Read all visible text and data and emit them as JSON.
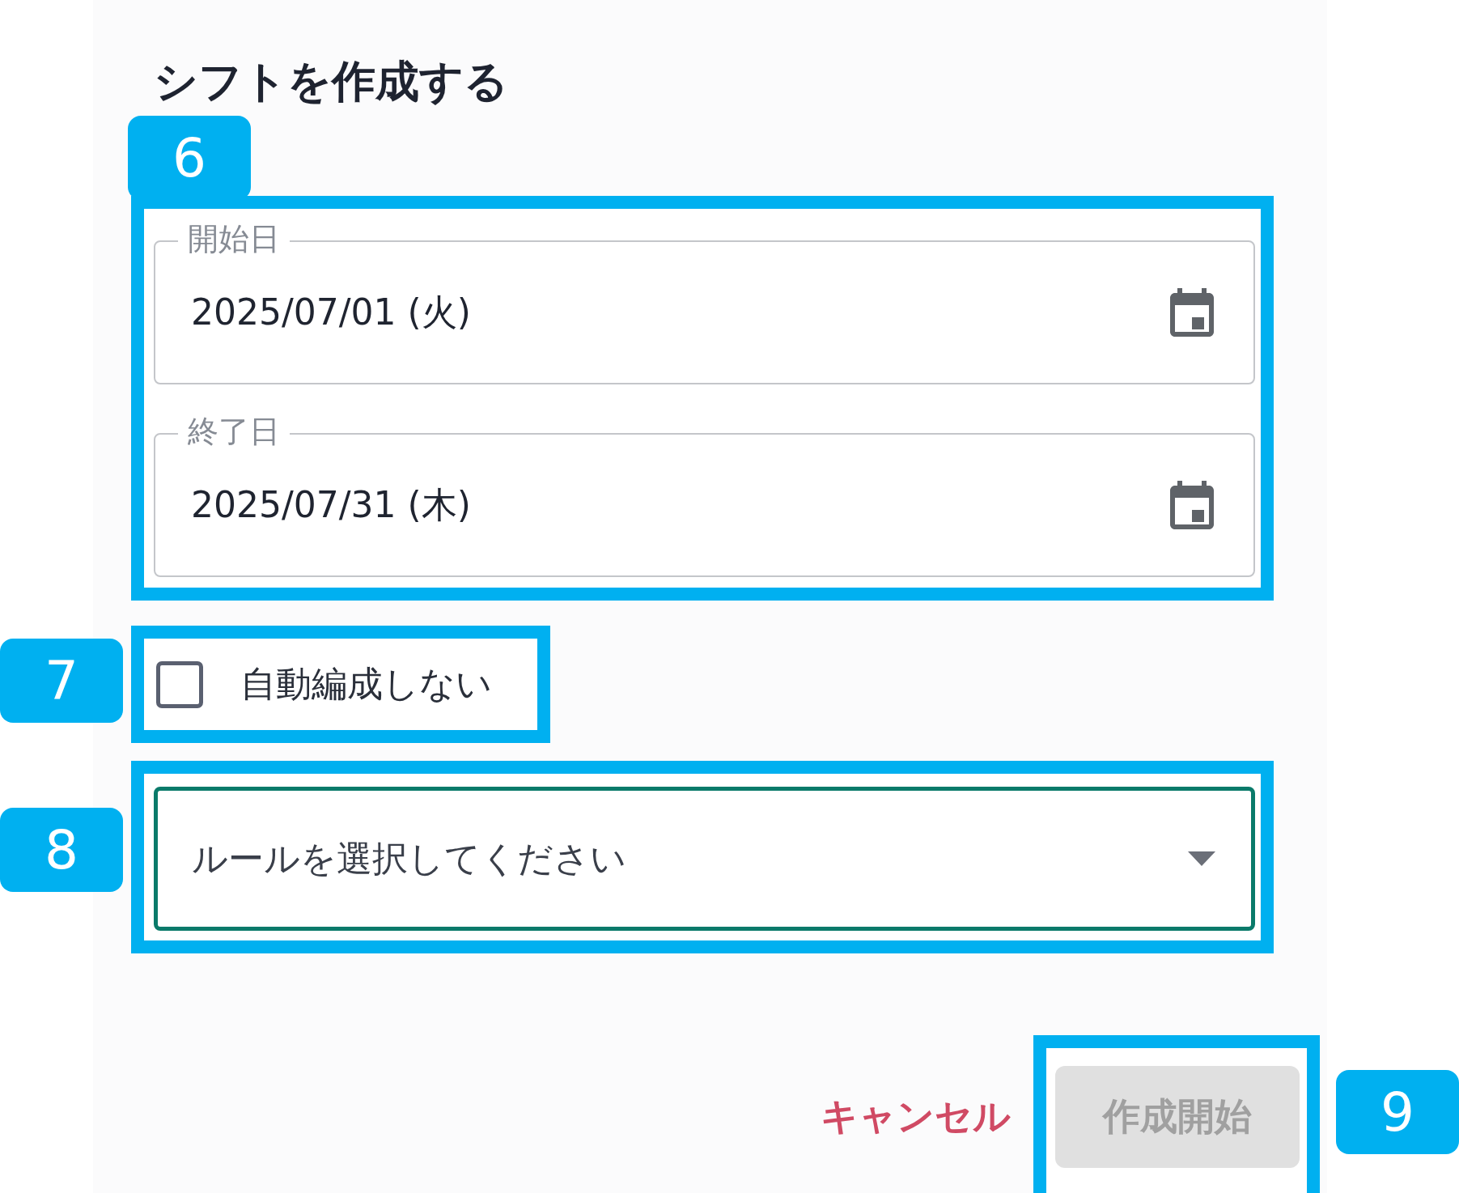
{
  "dialog": {
    "title": "シフトを作成する",
    "date_fields": [
      {
        "label": "開始日",
        "value": "2025/07/01 (火)"
      },
      {
        "label": "終了日",
        "value": "2025/07/31 (木)"
      }
    ],
    "auto_assign_checkbox": {
      "label": "自動編成しない",
      "checked": false
    },
    "rule_select": {
      "placeholder": "ルールを選択してください",
      "focused": true
    },
    "buttons": [
      {
        "label": "キャンセル",
        "kind": "text",
        "disabled": false
      },
      {
        "label": "作成開始",
        "kind": "filled",
        "disabled": true
      }
    ]
  },
  "annotations": [
    {
      "label": "6"
    },
    {
      "label": "7"
    },
    {
      "label": "8"
    },
    {
      "label": "9"
    }
  ]
}
